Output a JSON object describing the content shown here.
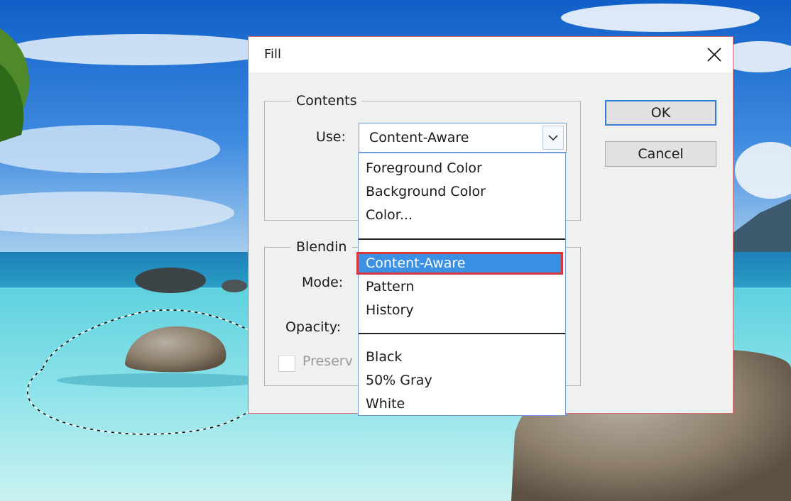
{
  "dialog": {
    "title": "Fill",
    "close_icon": "close-icon",
    "contents": {
      "legend": "Contents",
      "use_label": "Use:",
      "use_value": "Content-Aware"
    },
    "blending": {
      "legend": "Blendin",
      "mode_label": "Mode:",
      "opacity_label": "Opacity:",
      "preserve_label": "Preserv"
    },
    "buttons": {
      "ok": "OK",
      "cancel": "Cancel"
    }
  },
  "use_dropdown": {
    "groups": [
      [
        "Foreground Color",
        "Background Color",
        "Color..."
      ],
      [
        "Content-Aware",
        "Pattern",
        "History"
      ],
      [
        "Black",
        "50% Gray",
        "White"
      ]
    ],
    "selected": "Content-Aware"
  },
  "colors": {
    "dialog_border": "#d86b6b",
    "highlight": "#3b90e3",
    "selection_outline": "#d8363d",
    "ok_focus": "#2f7fd6"
  }
}
